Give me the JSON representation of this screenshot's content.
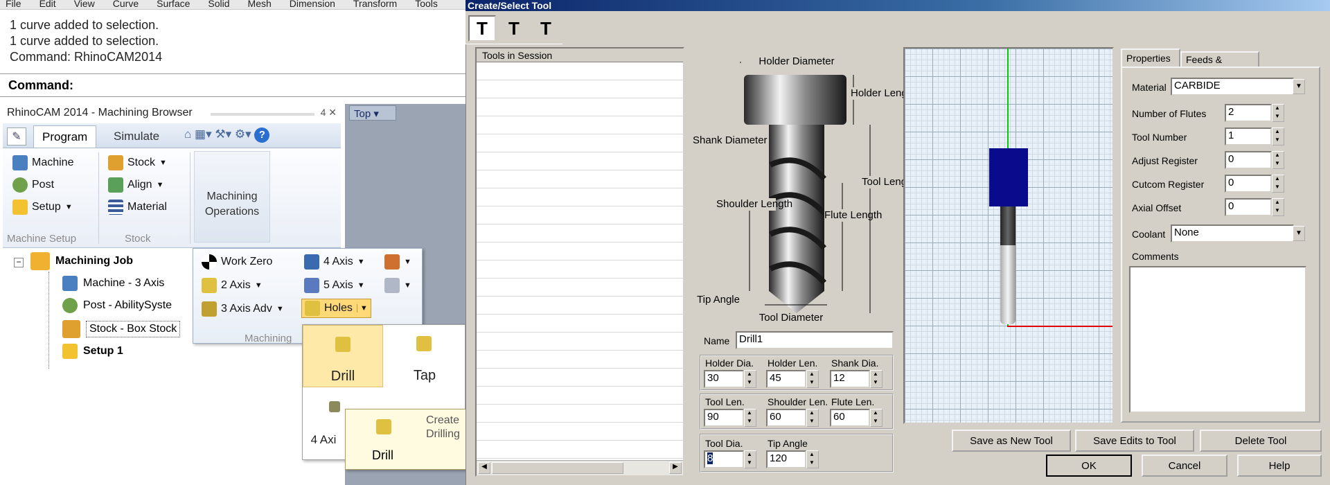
{
  "menu": [
    "File",
    "Edit",
    "View",
    "Curve",
    "Surface",
    "Solid",
    "Mesh",
    "Dimension",
    "Transform",
    "Tools"
  ],
  "history": [
    "1 curve added to selection.",
    "1 curve added to selection.",
    "Command: RhinoCAM2014"
  ],
  "command_label": "Command:",
  "browser": {
    "title": "RhinoCAM 2014 - Machining Browser",
    "pin": "4 ✕"
  },
  "ribbon": {
    "tabs": [
      "Program",
      "Simulate"
    ],
    "machine": "Machine",
    "post": "Post",
    "setup": "Setup",
    "stock": "Stock",
    "align": "Align",
    "material": "Material",
    "machining_ops": "Machining Operations",
    "grp_machine": "Machine Setup",
    "grp_stock": "Stock"
  },
  "tree": {
    "job": "Machining Job",
    "machine": "Machine - 3 Axis",
    "post": "Post - AbilitySyste",
    "stock": "Stock - Box Stock",
    "setup": "Setup 1"
  },
  "viewport": {
    "label": "Top"
  },
  "machpop": {
    "workzero": "Work Zero",
    "axis4": "4 Axis",
    "axis2": "2 Axis",
    "axis5": "5 Axis",
    "axis3": "3 Axis Adv",
    "holes": "Holes",
    "group": "Machining"
  },
  "holespop": {
    "drill": "Drill",
    "tap": "Tap",
    "axis4": "4 Axi"
  },
  "tooltip": {
    "drill": "Drill",
    "desc": "Create Drilling"
  },
  "dialog": {
    "title": "Create/Select Tool",
    "tools_header": "Tools in Session",
    "diagram": {
      "holder_diameter": "Holder Diameter",
      "holder_length": "Holder Length",
      "shank_diameter": "Shank Diameter",
      "tool_length": "Tool Length",
      "shoulder_length": "Shoulder Length",
      "flute_length": "Flute Length",
      "tip_angle": "Tip Angle",
      "tool_diameter": "Tool Diameter"
    },
    "name_label": "Name",
    "name_value": "Drill1",
    "fields": [
      {
        "label": "Holder Dia.",
        "value": "30"
      },
      {
        "label": "Holder Len.",
        "value": "45"
      },
      {
        "label": "Shank Dia.",
        "value": "12"
      },
      {
        "label": "Tool Len.",
        "value": "90"
      },
      {
        "label": "Shoulder Len.",
        "value": "60"
      },
      {
        "label": "Flute Len.",
        "value": "60"
      },
      {
        "label": "Tool Dia.",
        "value": "8"
      },
      {
        "label": "Tip Angle",
        "value": "120"
      }
    ],
    "tabs": [
      "Properties",
      "Feeds & Speeds"
    ],
    "props": {
      "material_label": "Material",
      "material_value": "CARBIDE",
      "flutes_label": "Number of Flutes",
      "flutes_value": "2",
      "toolnum_label": "Tool Number",
      "toolnum_value": "1",
      "adjreg_label": "Adjust Register",
      "adjreg_value": "0",
      "cutcom_label": "Cutcom Register",
      "cutcom_value": "0",
      "axial_label": "Axial Offset",
      "axial_value": "0",
      "coolant_label": "Coolant",
      "coolant_value": "None",
      "comments_label": "Comments"
    },
    "buttons": {
      "save_new": "Save as New Tool",
      "save_edits": "Save Edits to Tool",
      "delete": "Delete Tool",
      "ok": "OK",
      "cancel": "Cancel",
      "help": "Help"
    },
    "colors": {
      "holder": "#0a0a8c",
      "shank": "#3c3c3c",
      "axis_y": "#00d000",
      "axis_x": "#e00000",
      "grid_bg": "#e8f0f8"
    }
  }
}
